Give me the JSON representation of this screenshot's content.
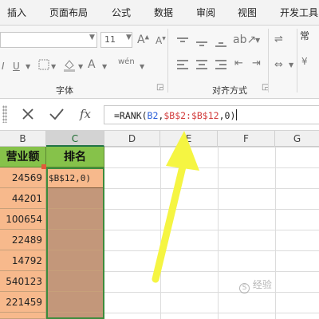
{
  "menu": {
    "tabs": [
      "插入",
      "页面布局",
      "公式",
      "数据",
      "审阅",
      "视图",
      "开发工具"
    ]
  },
  "ribbon": {
    "font_size": "11",
    "font_group_label": "字体",
    "align_group_label": "对齐方式",
    "right_edge_label": "常"
  },
  "formula_bar": {
    "cancel_icon": "close-icon",
    "enter_icon": "check-icon",
    "fx_label": "fx",
    "prefix": "=RANK(",
    "ref_cell": "B2",
    "sep1": ",",
    "ref_range": "$B$2:$B$12",
    "suffix": ",0)"
  },
  "columns": [
    "B",
    "C",
    "D",
    "E",
    "F",
    "G"
  ],
  "table": {
    "header_b": "营业额",
    "header_c": "排名",
    "values": [
      "24569",
      "44201",
      "100654",
      "22489",
      "14792",
      "540123",
      "221459"
    ],
    "edit_text": "$B$12,0)"
  },
  "annotation": {
    "arrow_color": "#f5f542",
    "arrow_icon": "yellow-arrow-icon"
  },
  "watermark": "经验"
}
